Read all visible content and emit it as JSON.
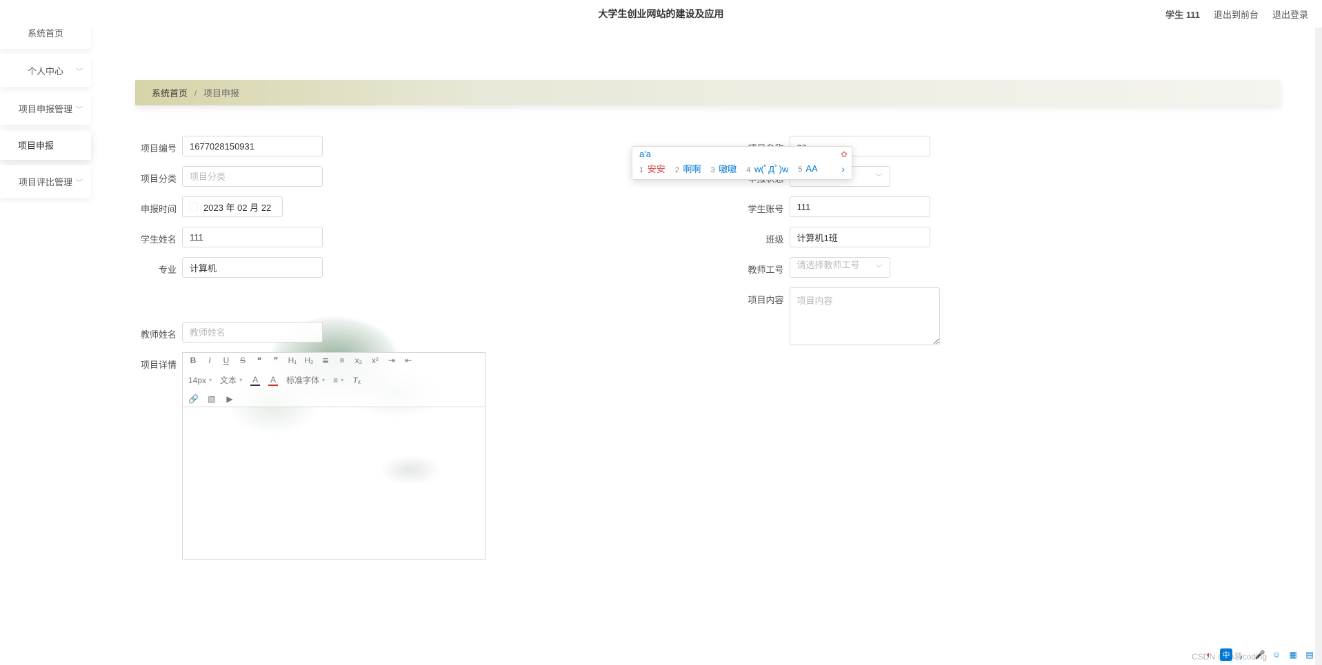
{
  "header": {
    "title": "大学生创业网站的建设及应用",
    "student_label": "学生 111",
    "exit_front": "退出到前台",
    "logout": "退出登录"
  },
  "sidebar": {
    "home": "系统首页",
    "personal": "个人中心",
    "project_apply_mgmt": "项目申报管理",
    "project_apply": "项目申报",
    "project_review_mgmt": "项目评比管理"
  },
  "breadcrumb": {
    "home": "系统首页",
    "current": "项目申报"
  },
  "form": {
    "left": {
      "project_no_label": "项目编号",
      "project_no": "1677028150931",
      "project_cat_label": "项目分类",
      "project_cat_placeholder": "项目分类",
      "apply_time_label": "申报时间",
      "apply_time": "2023 年 02 月 22 日",
      "student_name_label": "学生姓名",
      "student_name": "111",
      "major_label": "专业",
      "major": "计算机",
      "teacher_name_label": "教师姓名",
      "teacher_name_placeholder": "教师姓名",
      "project_detail_label": "项目详情"
    },
    "right": {
      "project_name_label": "项目名称",
      "project_name": "aa",
      "apply_status_label": "申报状态",
      "student_account_label": "学生账号",
      "student_account": "111",
      "class_label": "班级",
      "class": "计算机1班",
      "teacher_id_label": "教师工号",
      "teacher_id_placeholder": "请选择教师工号",
      "project_content_label": "项目内容",
      "project_content_placeholder": "项目内容"
    }
  },
  "editor": {
    "font_size": "14px",
    "font_family_label": "文本",
    "standard_font_label": "标准字体"
  },
  "ime": {
    "composition": "a'a",
    "candidates": [
      {
        "n": "1",
        "w": "安安"
      },
      {
        "n": "2",
        "w": "啊啊"
      },
      {
        "n": "3",
        "w": "嗷嗷"
      },
      {
        "n": "4",
        "w": "w(ﾟДﾟ)w"
      },
      {
        "n": "5",
        "w": "AA"
      }
    ],
    "more": "›"
  },
  "tray": {
    "ime_mode": "中",
    "watermark": "CSDN @小蓉coding"
  }
}
